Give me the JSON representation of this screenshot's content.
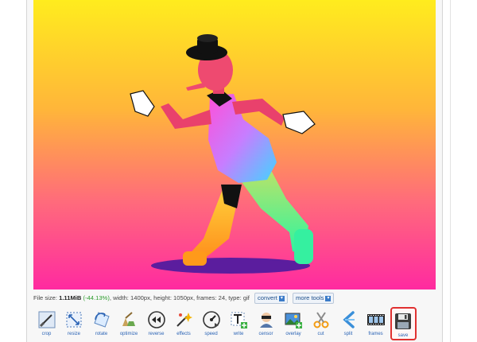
{
  "file_info": {
    "size_label": "File size:",
    "size_value": "1.11MiB",
    "size_change": "(-44.13%)",
    "details": ", width: 1400px, height: 1050px, frames: 24, type: gif"
  },
  "actions": {
    "convert_label": "convert",
    "more_tools_label": "more tools"
  },
  "tools": [
    {
      "label": "crop",
      "icon": "crop-icon"
    },
    {
      "label": "resize",
      "icon": "resize-icon"
    },
    {
      "label": "rotate",
      "icon": "rotate-icon"
    },
    {
      "label": "optimize",
      "icon": "optimize-icon"
    },
    {
      "label": "reverse",
      "icon": "reverse-icon"
    },
    {
      "label": "effects",
      "icon": "effects-icon"
    },
    {
      "label": "speed",
      "icon": "speed-icon"
    },
    {
      "label": "write",
      "icon": "write-icon"
    },
    {
      "label": "censor",
      "icon": "censor-icon"
    },
    {
      "label": "overlay",
      "icon": "overlay-icon"
    },
    {
      "label": "cut",
      "icon": "cut-icon"
    },
    {
      "label": "split",
      "icon": "split-icon"
    },
    {
      "label": "frames",
      "icon": "frames-icon"
    },
    {
      "label": "save",
      "icon": "save-icon"
    }
  ],
  "colors": {
    "accent": "#2a63b5",
    "highlight": "#e03131",
    "gain": "#2c9c2c"
  }
}
